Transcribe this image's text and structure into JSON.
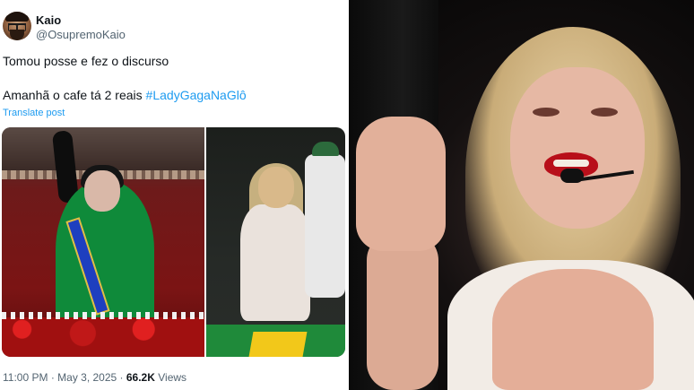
{
  "tweet": {
    "author": {
      "display_name": "Kaio",
      "handle": "@OsupremoKaio"
    },
    "text_line1": "Tomou posse e fez o discurso",
    "text_line2": "Amanhã o cafe tá 2 reais ",
    "hashtag": "#LadyGagaNaGlô",
    "translate_label": "Translate post",
    "meta": {
      "time": "11:00 PM",
      "separator": " · ",
      "date": "May 3, 2025",
      "views_count": "66.2K",
      "views_label": "Views"
    }
  },
  "colors": {
    "link": "#1d9bf0",
    "text": "#0f1419",
    "secondary_text": "#536471"
  },
  "icons": {
    "avatar": "avatar-icon"
  }
}
